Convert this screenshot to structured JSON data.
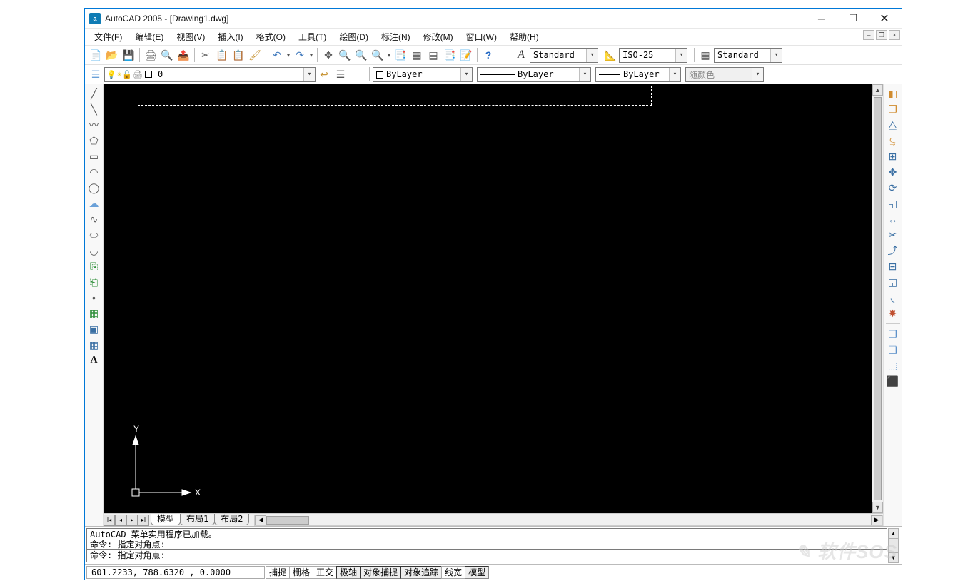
{
  "title": "AutoCAD 2005 - [Drawing1.dwg]",
  "appIconText": "a",
  "menu": [
    "文件(F)",
    "编辑(E)",
    "视图(V)",
    "插入(I)",
    "格式(O)",
    "工具(T)",
    "绘图(D)",
    "标注(N)",
    "修改(M)",
    "窗口(W)",
    "帮助(H)"
  ],
  "textStyle": "Standard",
  "dimStyle": "ISO-25",
  "tableStyle": "Standard",
  "layerCombo": "0",
  "colorCombo": "ByLayer",
  "linetypeCombo": "ByLayer",
  "lineweightCombo": "ByLayer",
  "plotStyleCombo": "随颜色",
  "ucs": {
    "x": "X",
    "y": "Y"
  },
  "tabs": [
    "模型",
    "布局1",
    "布局2"
  ],
  "cmdHistory": [
    "AutoCAD 菜单实用程序已加载。",
    "命令: 指定对角点:"
  ],
  "cmdLine": "命令: 指定对角点:",
  "coords": "601.2233, 788.6320 , 0.0000",
  "statusToggles": [
    {
      "label": "捕捉",
      "pressed": false
    },
    {
      "label": "栅格",
      "pressed": false
    },
    {
      "label": "正交",
      "pressed": false
    },
    {
      "label": "极轴",
      "pressed": true
    },
    {
      "label": "对象捕捉",
      "pressed": true
    },
    {
      "label": "对象追踪",
      "pressed": true
    },
    {
      "label": "线宽",
      "pressed": false
    },
    {
      "label": "模型",
      "pressed": true
    }
  ],
  "watermark": "软件SOS"
}
